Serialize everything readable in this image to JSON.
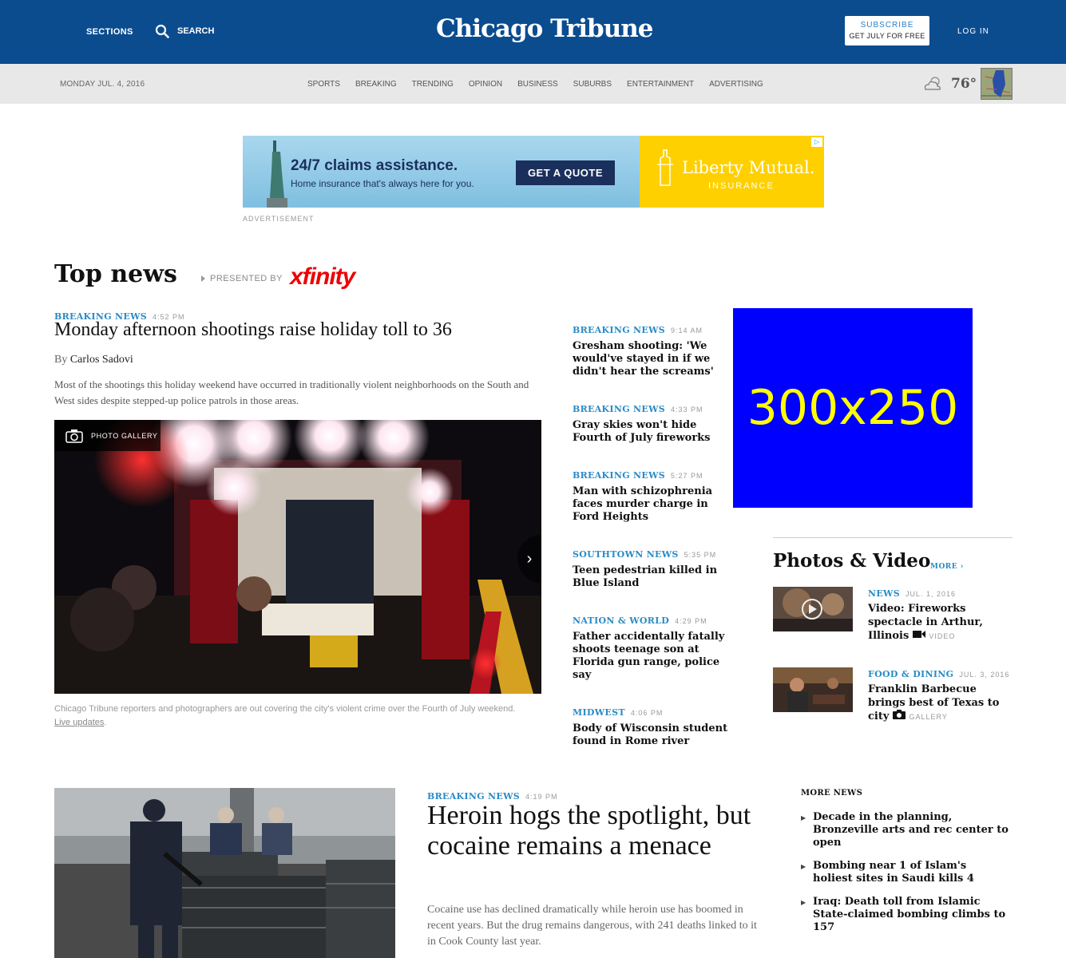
{
  "header": {
    "sections_label": "SECTIONS",
    "search_label": "SEARCH",
    "logo_text": "Chicago Tribune",
    "subscribe_line1": "SUBSCRIBE",
    "subscribe_line2": "GET JULY FOR FREE",
    "login_label": "LOG IN"
  },
  "nav": {
    "date": "MONDAY JUL. 4, 2016",
    "links": [
      "SPORTS",
      "BREAKING",
      "TRENDING",
      "OPINION",
      "BUSINESS",
      "SUBURBS",
      "ENTERTAINMENT",
      "ADVERTISING"
    ],
    "weather_temp": "76°",
    "weather_icon": "partly-cloudy-icon"
  },
  "ad_banner": {
    "headline": "24/7 claims assistance.",
    "subline": "Home insurance that's always here for you.",
    "cta": "GET A QUOTE",
    "brand": "Liberty Mutual.",
    "brand_sub": "INSURANCE",
    "label": "ADVERTISEMENT"
  },
  "top_news": {
    "title": "Top news",
    "presented_by": "PRESENTED BY",
    "sponsor": "xfinity"
  },
  "lead": {
    "kicker": "BREAKING NEWS",
    "time": "4:52 PM",
    "title": "Monday afternoon shootings raise holiday toll to 36",
    "by_prefix": "By",
    "author": "Carlos Sadovi",
    "description": "Most of the shootings this holiday weekend have occurred in traditionally violent neighborhoods on the South and West sides despite stepped-up police patrols in those areas.",
    "gallery_label": "PHOTO GALLERY",
    "caption": "Chicago Tribune reporters and photographers are out covering the city's violent crime over the Fourth of July weekend.",
    "caption_link": "Live updates"
  },
  "mid_list": [
    {
      "kicker": "BREAKING NEWS",
      "time": "9:14 AM",
      "title": "Gresham shooting: 'We would've stayed in if we didn't hear the screams'"
    },
    {
      "kicker": "BREAKING NEWS",
      "time": "4:33 PM",
      "title": "Gray skies won't hide Fourth of July fireworks"
    },
    {
      "kicker": "BREAKING NEWS",
      "time": "5:27 PM",
      "title": "Man with schizophrenia faces murder charge in Ford Heights"
    },
    {
      "kicker": "SOUTHTOWN NEWS",
      "time": "5:35 PM",
      "title": "Teen pedestrian killed in Blue Island"
    },
    {
      "kicker": "NATION & WORLD",
      "time": "4:29 PM",
      "title": "Father accidentally fatally shoots teenage son at Florida gun range, police say"
    },
    {
      "kicker": "MIDWEST",
      "time": "4:06 PM",
      "title": "Body of Wisconsin student found in Rome river"
    }
  ],
  "ad_box": {
    "text": "300x250"
  },
  "photos_video": {
    "title": "Photos & Video",
    "more": "MORE ›",
    "items": [
      {
        "kicker": "NEWS",
        "date": "JUL. 1, 2016",
        "title": "Video: Fireworks spectacle in Arthur, Illinois",
        "tag": "VIDEO"
      },
      {
        "kicker": "FOOD & DINING",
        "date": "JUL. 3, 2016",
        "title": "Franklin Barbecue brings best of Texas to city",
        "tag": "GALLERY"
      }
    ]
  },
  "second": {
    "kicker": "BREAKING NEWS",
    "time": "4:19 PM",
    "title": "Heroin hogs the spotlight, but cocaine remains a menace",
    "description": "Cocaine use has declined dramatically while heroin use has boomed in recent years. But the drug remains dangerous, with 241 deaths linked to it in Cook County last year."
  },
  "more_news": {
    "title": "MORE NEWS",
    "items": [
      "Decade in the planning, Bronzeville arts and rec center to open",
      "Bombing near 1 of Islam's holiest sites in Saudi kills 4",
      "Iraq: Death toll from Islamic State-claimed bombing climbs to 157"
    ]
  },
  "colors": {
    "header_blue": "#0b4c8f",
    "kicker_blue": "#2a8bc6",
    "nav_gray": "#e8e8e8"
  }
}
